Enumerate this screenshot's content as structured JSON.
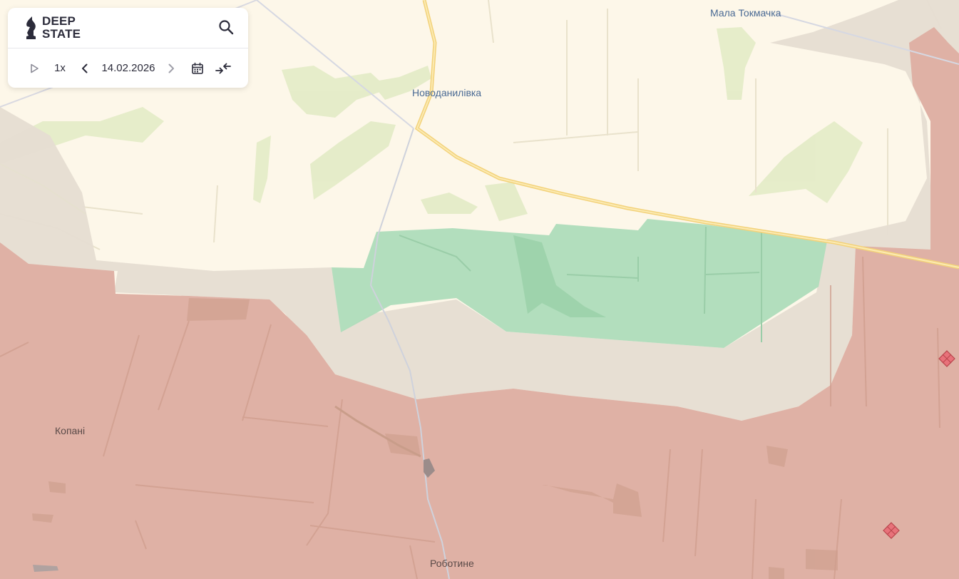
{
  "app": {
    "logo_line1": "DEEP",
    "logo_line2": "STATE"
  },
  "toolbar": {
    "speed_label": "1x",
    "date_value": "14.02.2026"
  },
  "icons": {
    "search": "search-icon",
    "play": "play-icon",
    "prev": "chevron-left-icon",
    "next": "chevron-right-icon",
    "calendar": "calendar-icon",
    "collapse": "collapse-arrows-icon"
  },
  "map": {
    "places": {
      "mala_tokmachka": "Мала Токмачка",
      "novodanylivka": "Новоданилівка",
      "kopani": "Копані",
      "robotyne": "Роботине"
    },
    "colors": {
      "background": "#fdf7e9",
      "occupied": "#dfb1a5",
      "gray_zone": "#e6dfd4",
      "liberated": "#aedcbb",
      "vegetation": "#e4ecc8",
      "road": "#f4d67a",
      "marker": "#e8727a"
    }
  }
}
